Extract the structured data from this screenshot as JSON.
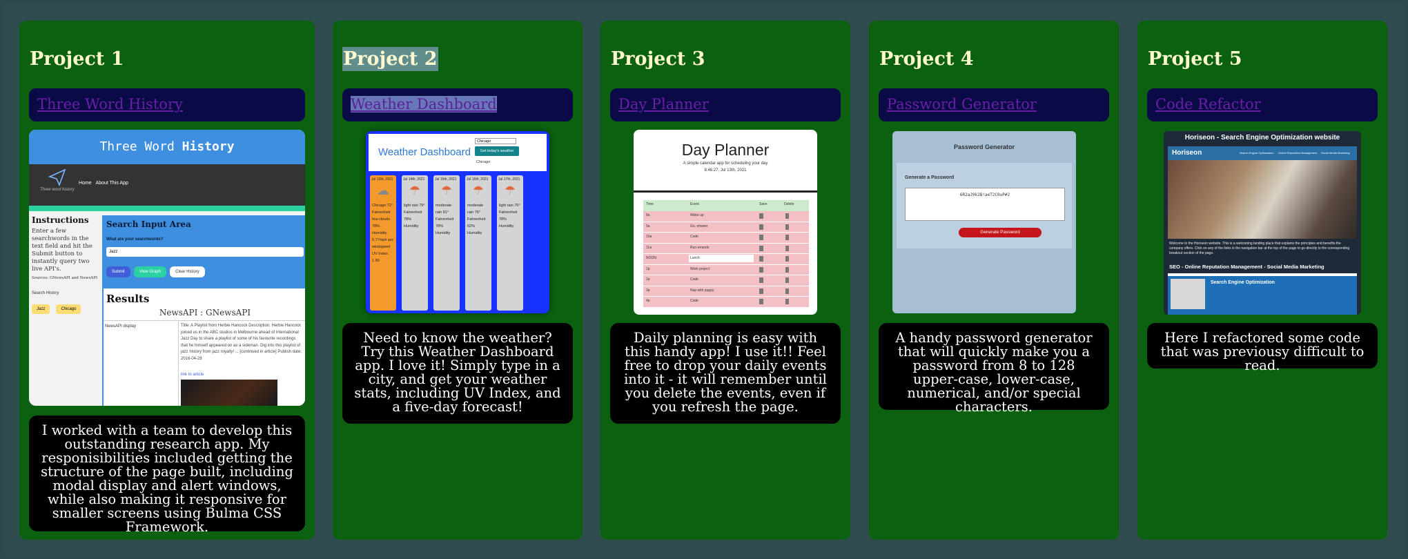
{
  "projects": [
    {
      "title": "Project 1",
      "link": "Three Word History",
      "description": "I worked with a team to develop this outstanding research app. My responisibilities included getting the structure of the page built, including modal display and alert windows, while also making it responsive for smaller screens using Bulma CSS Framework.",
      "preview": {
        "header_a": "Three Word ",
        "header_b": "History",
        "logo_text": "Three word history",
        "nav": [
          "Home",
          "About This App"
        ],
        "instructions_title": "Instructions",
        "instructions_text": "Enter a few searchwords in the text field and hit the Submit button to instantly query two live API's.",
        "sources": "Sources: GNewsAPI and NewsAPI",
        "search_history": "Search History",
        "history": [
          "Jazz",
          "Chicago"
        ],
        "search_area": "Search Input Area",
        "search_question": "What are your searchwords?",
        "search_value": "Jazz",
        "buttons": [
          "Submit",
          "View Graph",
          "Clear History"
        ],
        "results": "Results",
        "results_sub": "NewsAPI : GNewsAPI",
        "newsapi_label": "NewsAPI display",
        "article": "Title: A Playlist from Herbie Hancock Description: Herbie Hancock joined us in the ABC studios in Melbourne ahead of International Jazz Day to share a playlist of some of his favourite recordings that he himself appeared on as a sideman. Dig into this playlist of jazz history from jazz royalty! ... [continued in article] Publish date: 2016-04-28",
        "article_link": "link to article"
      }
    },
    {
      "title": "Project 2",
      "link": "Weather Dashboard",
      "description": "Need to know the weather? Try this Weather Dashboard app. I love it! Simply type in a city, and get your weather stats, including UV Index, and a five-day forecast!",
      "preview": {
        "heading": "Weather Dashboard",
        "city_input": "Chicago",
        "get_button": "Get today's weather",
        "recent": "Chicago",
        "days": [
          {
            "date": "Jul 13th, 2021",
            "text": "Chicago 72° Fahrenheit few clouds 78% Humidity 5.77mph are windspeed UV Index: 1.50"
          },
          {
            "date": "Jul 14th, 2021",
            "text": "light rain 79° Fahrenheit 78% Humidity"
          },
          {
            "date": "Jul 15th, 2021",
            "text": "moderate rain 81° Fahrenheit 78% Humidity"
          },
          {
            "date": "Jul 16th, 2021",
            "text": "moderate rain 76° Fahrenheit 62% Humidity"
          },
          {
            "date": "Jul 17th, 2021",
            "text": "light rain 76° Fahrenheit 78% Humidity"
          }
        ]
      }
    },
    {
      "title": "Project 3",
      "link": "Day Planner",
      "description": "Daily planning is easy with this handy app! I use it!! Feel free to drop your daily events into it - it will remember until you delete the events, even if you refresh the page.",
      "preview": {
        "heading": "Day Planner",
        "subtitle": "A simple calendar app for scheduling your day",
        "date": "8:46:27, Jul 13th, 2021",
        "headers": [
          "Time",
          "Event",
          "Save",
          "Delete"
        ],
        "rows": [
          {
            "time": "8a",
            "event": "Wake up"
          },
          {
            "time": "9a",
            "event": "Go, shower"
          },
          {
            "time": "10a",
            "event": "Code"
          },
          {
            "time": "11a",
            "event": "Run errands"
          },
          {
            "time": "NOON",
            "event": "Lunch"
          },
          {
            "time": "1p",
            "event": "Work project"
          },
          {
            "time": "2p",
            "event": "Code"
          },
          {
            "time": "3p",
            "event": "Nap with puppy"
          },
          {
            "time": "4p",
            "event": "Code"
          }
        ]
      }
    },
    {
      "title": "Project 4",
      "link": "Password Generator",
      "description": "A handy password generator that will quickly make you a password from 8 to 128 upper-case, lower-case, numerical, and/or special characters.",
      "preview": {
        "heading": "Password Generator",
        "subheading": "Generate a Password",
        "password": "6R2aJ9k2B!aeT2C0uP#2",
        "button": "Generate Password"
      }
    },
    {
      "title": "Project 5",
      "link": "Code Refactor",
      "description": "Here I refactored some code that was previousy difficult to read.",
      "preview": {
        "heading": "Horiseon - Search Engine Optimization website",
        "brand": "Horiseon",
        "nav": [
          "Search Engine Optimization",
          "Online Reputation Management",
          "Social Media Marketing"
        ],
        "intro": "Welcome to the Horiseon website. This is a welcoming landing place that explains the principles and benefits the company offers. Click on any of the links in the navigation bar at the top of the page to go directly to the corresponding breakout section of the page.",
        "seo_line": "SEO - Online Reputation Management - Social Media Marketing",
        "section_title": "Search Engine Optimization"
      }
    }
  ],
  "colors": {
    "page": "#2c4a4c",
    "card": "#0c6110",
    "title": "#fff9d0",
    "link_box": "#0a0a46",
    "link": "#6a1fa8",
    "description_bg": "#000000"
  }
}
